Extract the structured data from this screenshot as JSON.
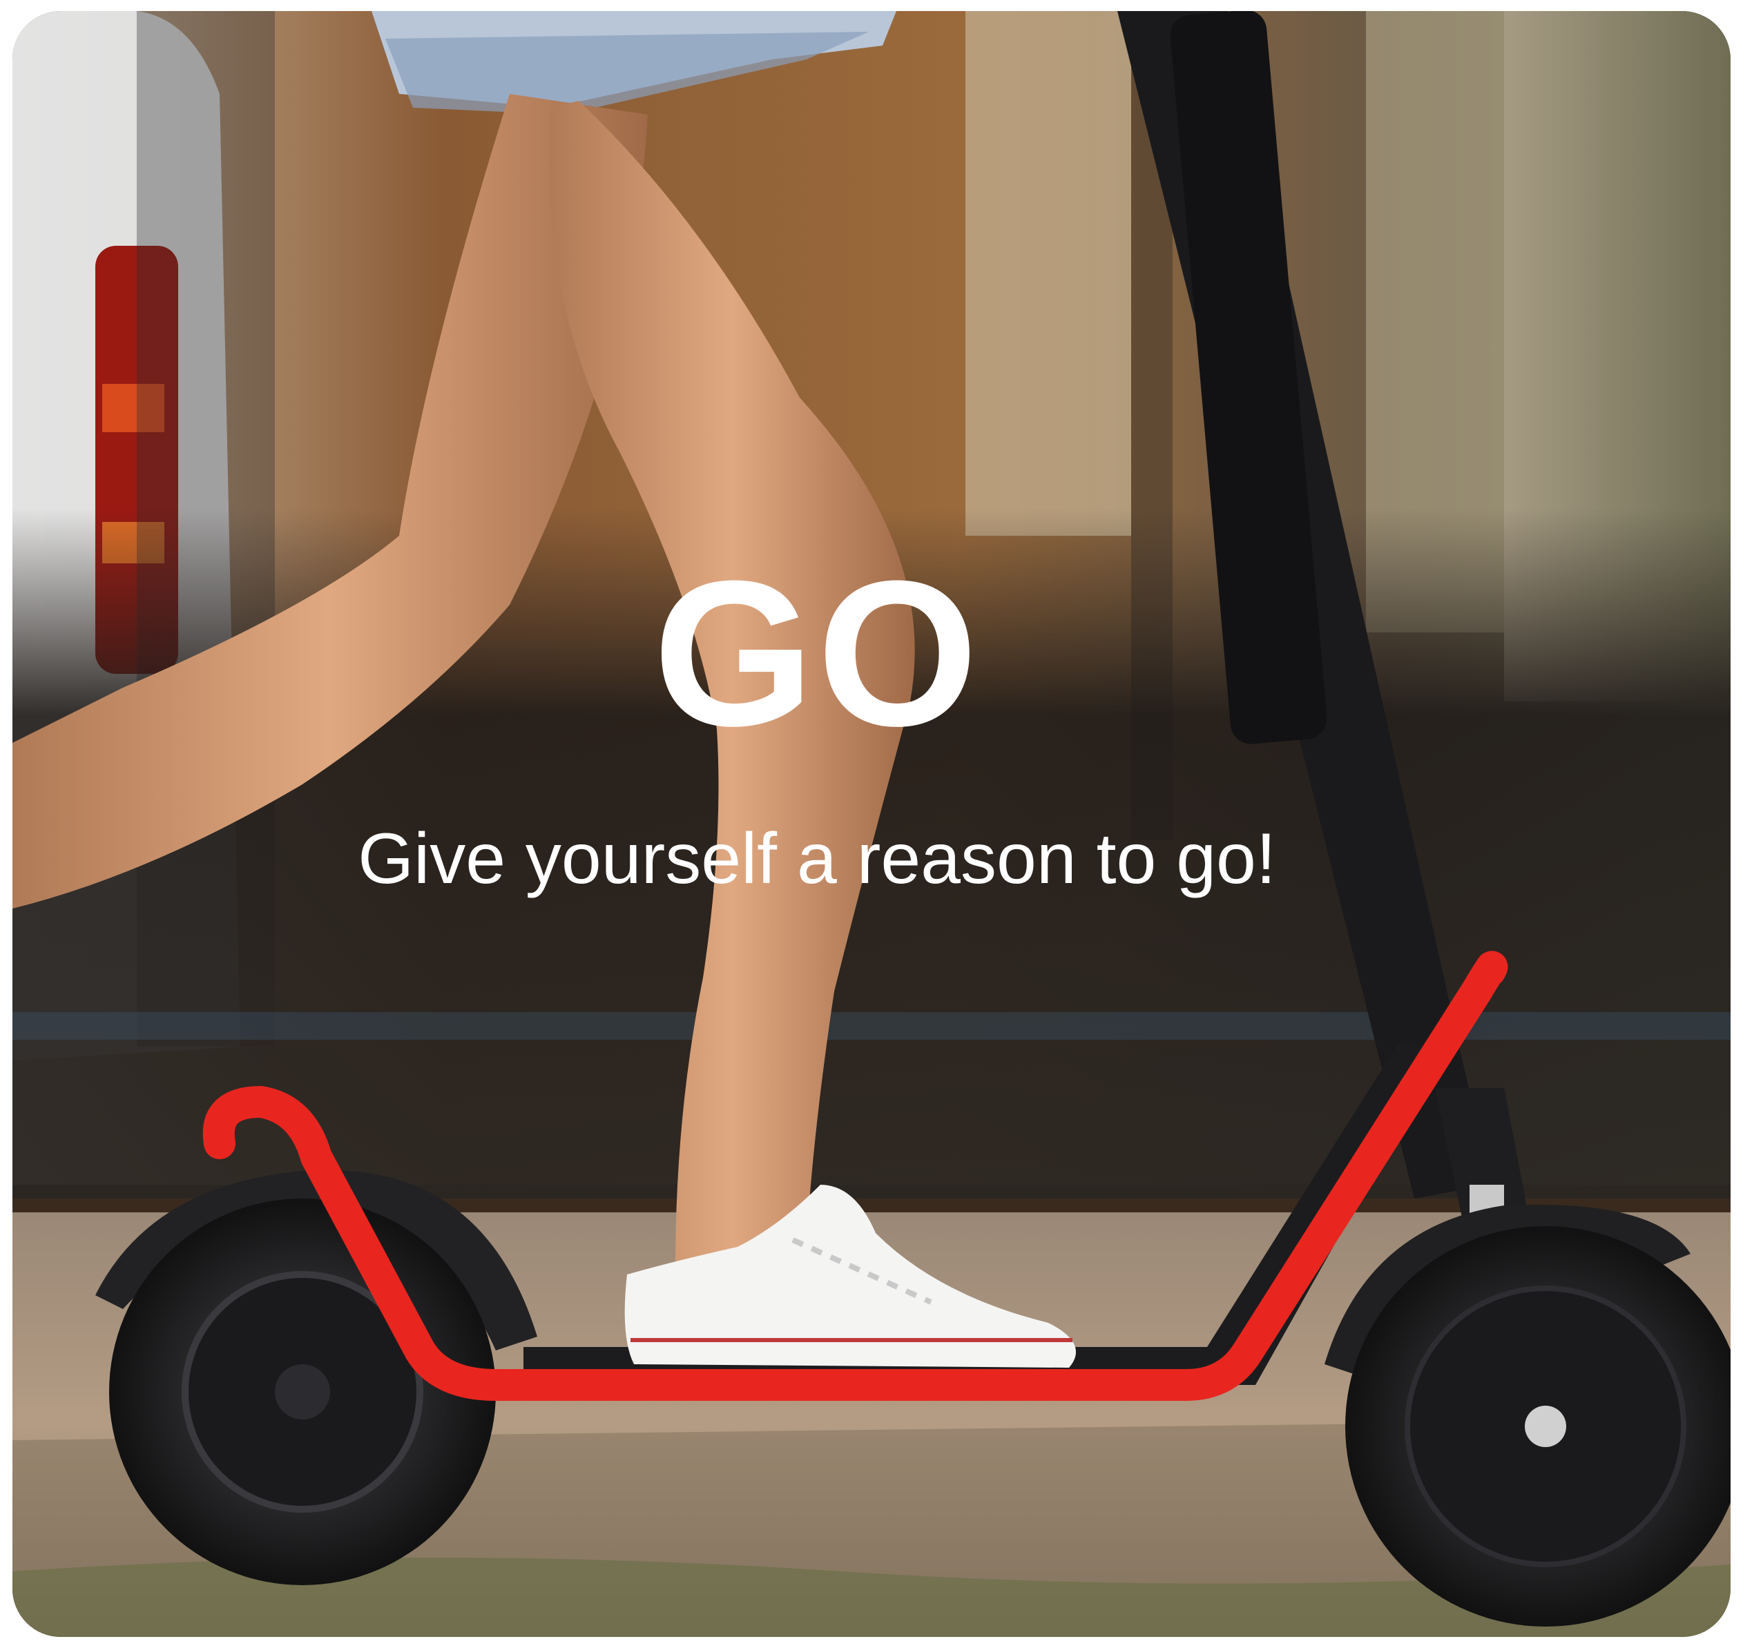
{
  "promo": {
    "headline": "GO",
    "tagline": "Give yourself a reason to go!"
  },
  "colors": {
    "frame_accent": "#e8261f",
    "deck": "#1c1c1e",
    "text": "#ffffff"
  },
  "photo": {
    "subject_icon": "electric-scooter-photo"
  }
}
